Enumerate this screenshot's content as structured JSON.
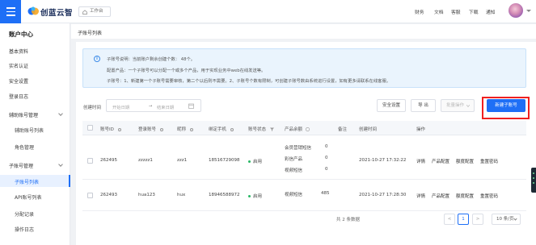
{
  "brand": {
    "name": "创蓝云智",
    "accent": "#1e6ff6"
  },
  "header": {
    "home_tab": "工作台",
    "links": [
      "财务",
      "文档",
      "客服",
      "下载",
      "通知"
    ]
  },
  "sidebar": {
    "title": "账户中心",
    "items": [
      {
        "label": "基本资料"
      },
      {
        "label": "实名认证"
      },
      {
        "label": "安全设置"
      },
      {
        "label": "登录日志"
      },
      {
        "label": "辅助账号管理",
        "children": [
          "辅助账号列表",
          "角色管理"
        ]
      },
      {
        "label": "子账号管理",
        "children": [
          "子账号列表",
          "API账号列表",
          "分配记录",
          "操作日志"
        ]
      }
    ]
  },
  "page": {
    "title": "子账号列表"
  },
  "info": {
    "line1": "子账号说明：当前账户剩余创建个数： 48个。",
    "line2": "配置产品：一个子账号可以分配一个或多个产品，用于实现业务中web在线发送等。",
    "line3": "子账号：1、新建第一个子账号需要审核，第二个以后则不需要。2、子账号个数有限制，可创建子账号数由系统进行设置，如有更多请联系在线客服。"
  },
  "filter": {
    "label": "创建时间",
    "start_placeholder": "开始日期",
    "separator": "→",
    "end_placeholder": "结束日期"
  },
  "actions": {
    "security": "安全设置",
    "export": "导 出",
    "batch": "批量操作",
    "create": "新建子账号"
  },
  "table": {
    "headers": [
      "账号ID",
      "登录账号",
      "昵称",
      "绑定手机",
      "账号状态",
      "产品余额",
      "备注",
      "创建时间",
      "操作"
    ],
    "rows": [
      {
        "id": "262495",
        "login": "zzzzz1",
        "nick": "zzz1",
        "phone": "18516729098",
        "status": "启用",
        "balances": [
          {
            "name": "会员营销短信",
            "value": "0"
          },
          {
            "name": "彩信产品",
            "value": "0"
          },
          {
            "name": "视频短信",
            "value": "0"
          }
        ],
        "note": "",
        "created": "2021-10-27 17:32:22",
        "ops": [
          "详情",
          "产品配置",
          "额度配置",
          "重置密码"
        ]
      },
      {
        "id": "262493",
        "login": "hua123",
        "nick": "hux",
        "phone": "18946588972",
        "status": "启用",
        "balances": [
          {
            "name": "视频短信",
            "value": "485"
          }
        ],
        "note": "",
        "created": "2021-10-27 17:28:30",
        "ops": [
          "详情",
          "产品配置",
          "额度配置",
          "重置密码"
        ]
      }
    ]
  },
  "pagination": {
    "total": "共 2 条数据",
    "prev": "<",
    "current": "1",
    "next": ">",
    "page_size": "10 条/页"
  }
}
